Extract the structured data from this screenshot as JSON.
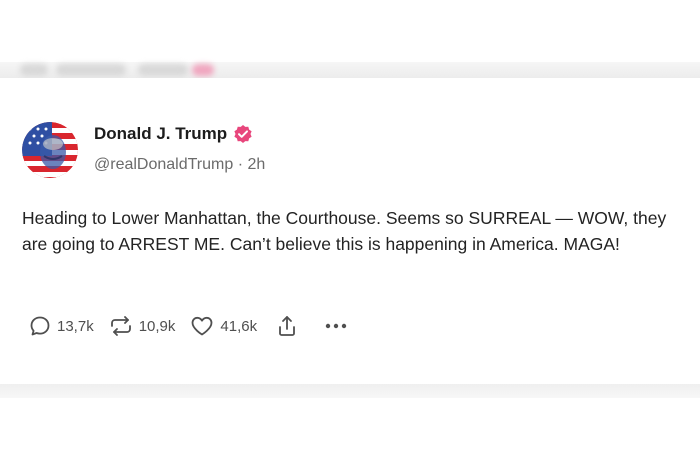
{
  "post": {
    "author": {
      "display_name": "Donald J. Trump",
      "handle": "@realDonaldTrump",
      "time": "2h",
      "verified_badge_color": "#e8467c"
    },
    "text": "Heading to Lower Manhattan, the Courthouse. Seems so SURREAL — WOW, they are going to ARREST ME. Can’t believe this is happening in America. MAGA!",
    "actions": {
      "replies": "13,7k",
      "reposts": "10,9k",
      "likes": "41,6k"
    }
  },
  "icons": {
    "reply": "reply-bubble-icon",
    "repost": "repost-arrows-icon",
    "like": "heart-icon",
    "share": "share-upload-icon",
    "more": "more-dots-icon"
  },
  "colors": {
    "text": "#232323",
    "muted": "#6b6b6b",
    "badge": "#e8467c"
  }
}
